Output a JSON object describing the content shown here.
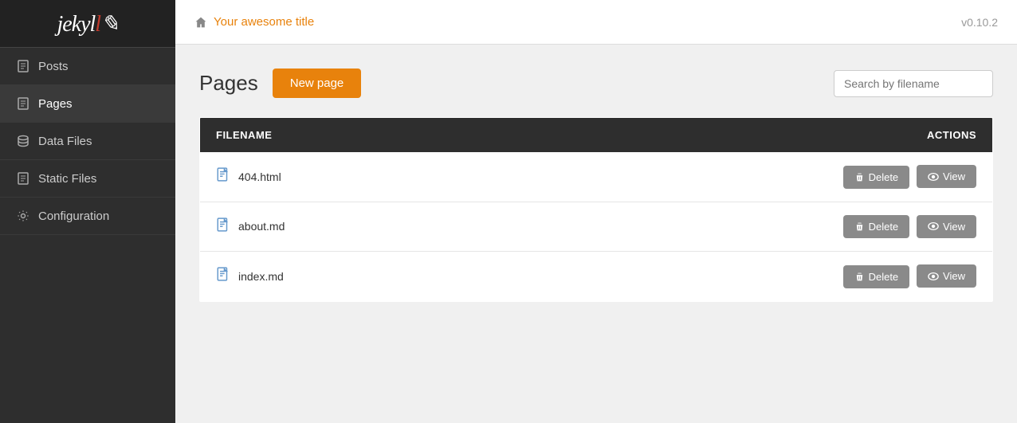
{
  "sidebar": {
    "logo": "jekyll",
    "logo_accent": "!",
    "nav_items": [
      {
        "id": "posts",
        "label": "Posts",
        "icon": "file-icon"
      },
      {
        "id": "pages",
        "label": "Pages",
        "icon": "file-icon",
        "active": true
      },
      {
        "id": "data-files",
        "label": "Data Files",
        "icon": "database-icon"
      },
      {
        "id": "static-files",
        "label": "Static Files",
        "icon": "file-icon"
      },
      {
        "id": "configuration",
        "label": "Configuration",
        "icon": "gear-icon"
      }
    ]
  },
  "header": {
    "site_title": "Your awesome title",
    "version": "v0.10.2"
  },
  "main": {
    "page_title": "Pages",
    "new_page_label": "New page",
    "search_placeholder": "Search by filename",
    "table": {
      "col_filename": "FILENAME",
      "col_actions": "ACTIONS",
      "rows": [
        {
          "filename": "404.html"
        },
        {
          "filename": "about.md"
        },
        {
          "filename": "index.md"
        }
      ]
    },
    "btn_delete": "Delete",
    "btn_view": "View"
  }
}
